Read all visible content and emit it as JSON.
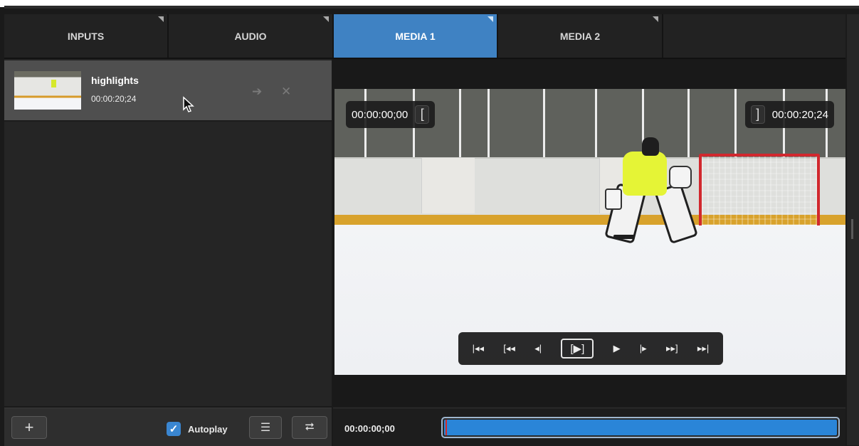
{
  "tabs": [
    {
      "label": "INPUTS",
      "active": false
    },
    {
      "label": "AUDIO",
      "active": false
    },
    {
      "label": "MEDIA 1",
      "active": true
    },
    {
      "label": "MEDIA 2",
      "active": false
    },
    {
      "label": "",
      "active": false
    }
  ],
  "media_list": {
    "items": [
      {
        "name": "highlights",
        "duration": "00:00:20;24",
        "thumbnail": "hockey-goalie-thumbnail"
      }
    ],
    "item_actions": [
      "arrow-icon",
      "close-icon"
    ]
  },
  "left_footer": {
    "add_icon": "+",
    "autoplay_label": "Autoplay",
    "autoplay_checked": true,
    "checkbox_glyph": "✓",
    "playlist_icon": "☰",
    "loop_icon": "⮂"
  },
  "preview": {
    "in_point": "00:00:00;00",
    "out_point": "00:00:20;24",
    "in_bracket": "[",
    "out_bracket": "]",
    "image": "ice-hockey-goalie-in-crease"
  },
  "transport": [
    {
      "name": "go-to-start-button",
      "glyph": "|◂◂"
    },
    {
      "name": "go-to-in-point-button",
      "glyph": "[◂◂"
    },
    {
      "name": "step-back-button",
      "glyph": "◂|"
    },
    {
      "name": "play-pause-button",
      "glyph": "[▶]"
    },
    {
      "name": "play-button",
      "glyph": "▶"
    },
    {
      "name": "step-forward-button",
      "glyph": "|▸"
    },
    {
      "name": "go-to-out-point-button",
      "glyph": "▸▸]"
    },
    {
      "name": "go-to-end-button",
      "glyph": "▸▸|"
    }
  ],
  "scrubber": {
    "current_time": "00:00:00;00",
    "position_fraction": 0.0
  },
  "colors": {
    "active_tab": "#3f82c3",
    "scrub_fill": "#2a85d8",
    "playhead": "#d22b2b",
    "checkbox": "#3a86d1"
  }
}
